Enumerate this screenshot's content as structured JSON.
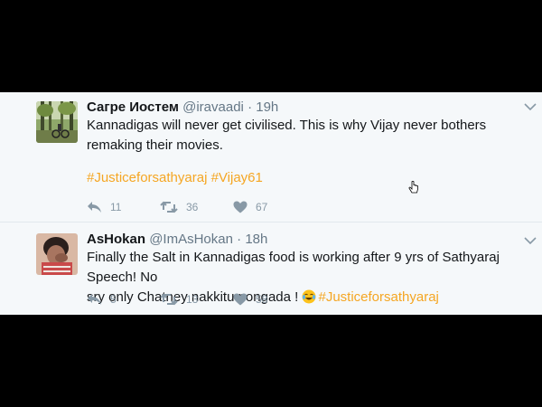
{
  "tweets": [
    {
      "name": "Сагре Иостем",
      "handle": "@iravaadi",
      "separator": "·",
      "time": "19h",
      "text": "Kannadigas will never get civilised. This is why Vijay never bothers remaking their movies.",
      "hashtags": [
        "#Justiceforsathyaraj",
        "#Vijay61"
      ],
      "replies": "11",
      "retweets": "36",
      "likes": "67",
      "avatar_icon": "forest-photo-avatar"
    },
    {
      "name": "AsHokan",
      "handle": "@ImAsHokan",
      "separator": "·",
      "time": "18h",
      "text_line1": "Finally the Salt in Kannadigas food is working after 9 yrs of Sathyaraj Speech! No",
      "text_line2": "sry only Chatney nakkitu pongada !",
      "emoji_icon": "tears-of-joy-emoji-icon",
      "hashtag": "#Justiceforsathyaraj",
      "replies": "5",
      "retweets": "13",
      "likes": "58",
      "avatar_icon": "person-photo-avatar"
    }
  ],
  "colors": {
    "hashtag": "#f5a623",
    "icon_gray": "#8899a6",
    "background": "#f5f8fa"
  }
}
